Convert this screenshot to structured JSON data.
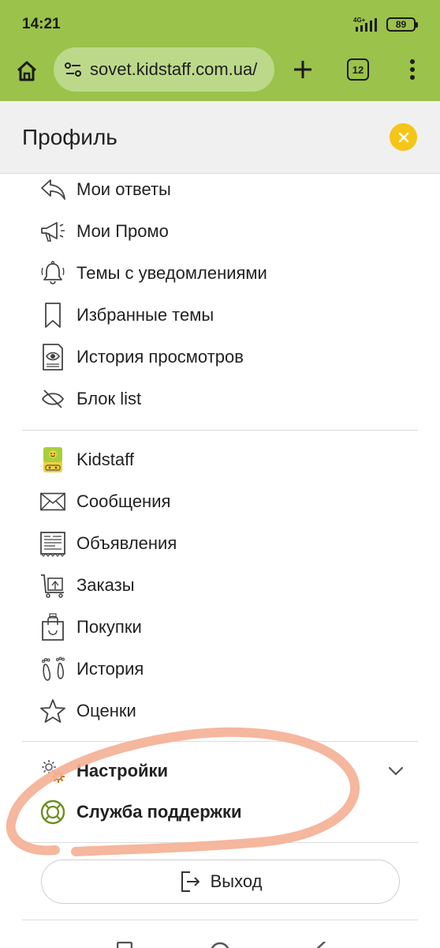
{
  "status_bar": {
    "time": "14:21",
    "network": "4G+",
    "battery": "89"
  },
  "browser": {
    "url": "sovet.kidstaff.com.ua/",
    "tab_count": "12",
    "accent_color": "#9bc24a"
  },
  "profile_panel": {
    "title": "Профиль",
    "section1": [
      {
        "label": "Мои ответы",
        "icon": "reply-icon"
      },
      {
        "label": "Мои Промо",
        "icon": "megaphone-icon"
      },
      {
        "label": "Темы с уведомлениями",
        "icon": "bell-icon"
      },
      {
        "label": "Избранные темы",
        "icon": "bookmark-icon"
      },
      {
        "label": "История просмотров",
        "icon": "view-history-icon"
      },
      {
        "label": "Блок list",
        "icon": "hidden-icon"
      }
    ],
    "section2": [
      {
        "label": "Kidstaff",
        "icon": "kidstaff-logo-icon"
      },
      {
        "label": "Сообщения",
        "icon": "envelope-icon"
      },
      {
        "label": "Объявления",
        "icon": "ads-icon"
      },
      {
        "label": "Заказы",
        "icon": "orders-icon"
      },
      {
        "label": "Покупки",
        "icon": "shopping-bag-icon"
      },
      {
        "label": "История",
        "icon": "footprints-icon"
      },
      {
        "label": "Оценки",
        "icon": "star-icon"
      }
    ],
    "settings": {
      "label": "Настройки",
      "icon": "gears-icon"
    },
    "support": {
      "label": "Служба поддержки",
      "icon": "lifebuoy-icon"
    },
    "logout": {
      "label": "Выход",
      "icon": "logout-icon"
    }
  }
}
